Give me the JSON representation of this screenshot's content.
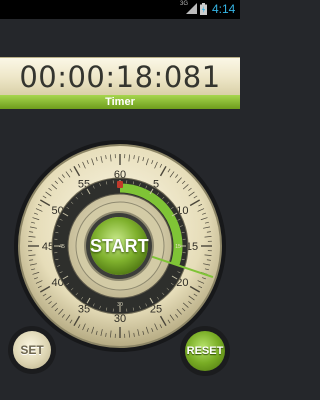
{
  "status_bar": {
    "network": "3G",
    "time": "4:14",
    "signal_icon": "signal-icon",
    "battery_icon": "battery-icon"
  },
  "timer": {
    "display": "00:00:18:081",
    "mode_label": "Timer"
  },
  "dial": {
    "outer_labels": [
      "60",
      "5",
      "10",
      "15",
      "20",
      "25",
      "30",
      "35",
      "40",
      "45",
      "50",
      "55"
    ],
    "inner_labels": [
      "15",
      "30",
      "45"
    ],
    "hand_seconds": 18.081,
    "progress_fraction": 0.301
  },
  "buttons": {
    "start": "START",
    "set": "SET",
    "reset": "RESET"
  },
  "colors": {
    "accent_green": "#7fb12d",
    "bezel": "#e3dab6",
    "background": "#25272b"
  }
}
